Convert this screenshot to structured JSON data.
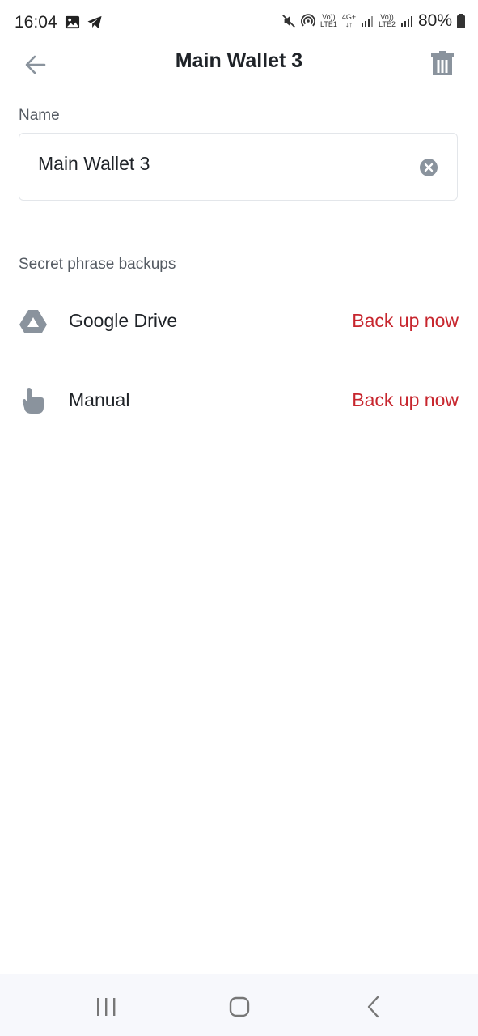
{
  "status_bar": {
    "time": "16:04",
    "sim1_top": "Vo))",
    "sim1_bottom": "LTE1",
    "network_top": "4G+",
    "network_bottom": "↓↑",
    "sim2_top": "Vo))",
    "sim2_bottom": "LTE2",
    "battery": "80%"
  },
  "header": {
    "title": "Main Wallet 3"
  },
  "name_section": {
    "label": "Name",
    "value": "Main Wallet 3"
  },
  "backups": {
    "title": "Secret phrase backups",
    "items": [
      {
        "label": "Google Drive",
        "action": "Back up now",
        "icon": "google-drive-icon"
      },
      {
        "label": "Manual",
        "action": "Back up now",
        "icon": "hand-pointer-icon"
      }
    ]
  },
  "colors": {
    "accent_red": "#c7262e",
    "icon_gray": "#8a939d"
  }
}
